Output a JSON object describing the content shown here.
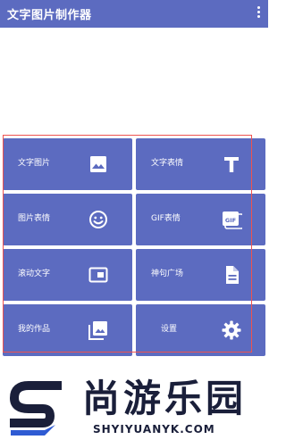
{
  "appbar": {
    "title": "文字图片制作器",
    "background": "#5c6bc0"
  },
  "tiles": [
    {
      "label": "文字图片",
      "icon": "image-icon"
    },
    {
      "label": "文字表情",
      "icon": "text-t-icon"
    },
    {
      "label": "图片表情",
      "icon": "smiley-icon"
    },
    {
      "label": "GIF表情",
      "icon": "gif-icon"
    },
    {
      "label": "滚动文字",
      "icon": "scrolling-window-icon"
    },
    {
      "label": "神句广场",
      "icon": "document-icon"
    },
    {
      "label": "我的作品",
      "icon": "photo-library-icon"
    },
    {
      "label": "设置",
      "icon": "gear-icon"
    }
  ],
  "colors": {
    "tile": "#5c6bc0",
    "highlight": "#ef5350",
    "watermark_text": "#1a1f3a",
    "watermark_accent": "#2f5bd3"
  },
  "watermark": {
    "chinese": "尚游乐园",
    "english": "SHYIYUANYK.COM"
  }
}
